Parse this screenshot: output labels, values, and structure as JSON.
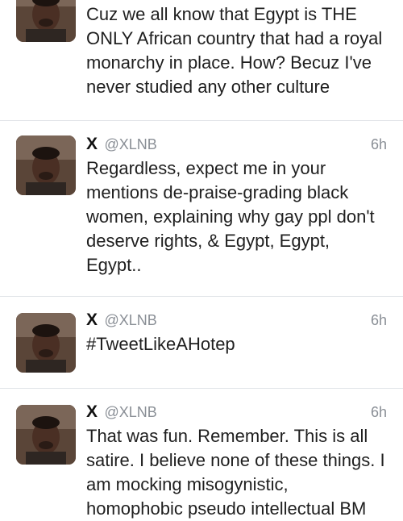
{
  "tweets": [
    {
      "name": "",
      "handle": "",
      "time": "",
      "text": "Cuz we all know that Egypt is THE\nONLY African country that had a royal\nmonarchy in place. How? Becuz I've\nnever studied any other culture"
    },
    {
      "name": "X",
      "handle": "@XLNB",
      "time": "6h",
      "text": "Regardless, expect me in your\nmentions de-praise-grading black\nwomen, explaining why gay ppl don't\ndeserve rights, & Egypt, Egypt,\nEgypt.."
    },
    {
      "name": "X",
      "handle": "@XLNB",
      "time": "6h",
      "text": "#TweetLikeAHotep"
    },
    {
      "name": "X",
      "handle": "@XLNB",
      "time": "6h",
      "text": "That was fun. Remember. This is all\nsatire. I believe none of these things. I\nam mocking misogynistic,\nhomophobic pseudo intellectual BM"
    }
  ],
  "icons": {
    "avatar": "profile-photo"
  }
}
